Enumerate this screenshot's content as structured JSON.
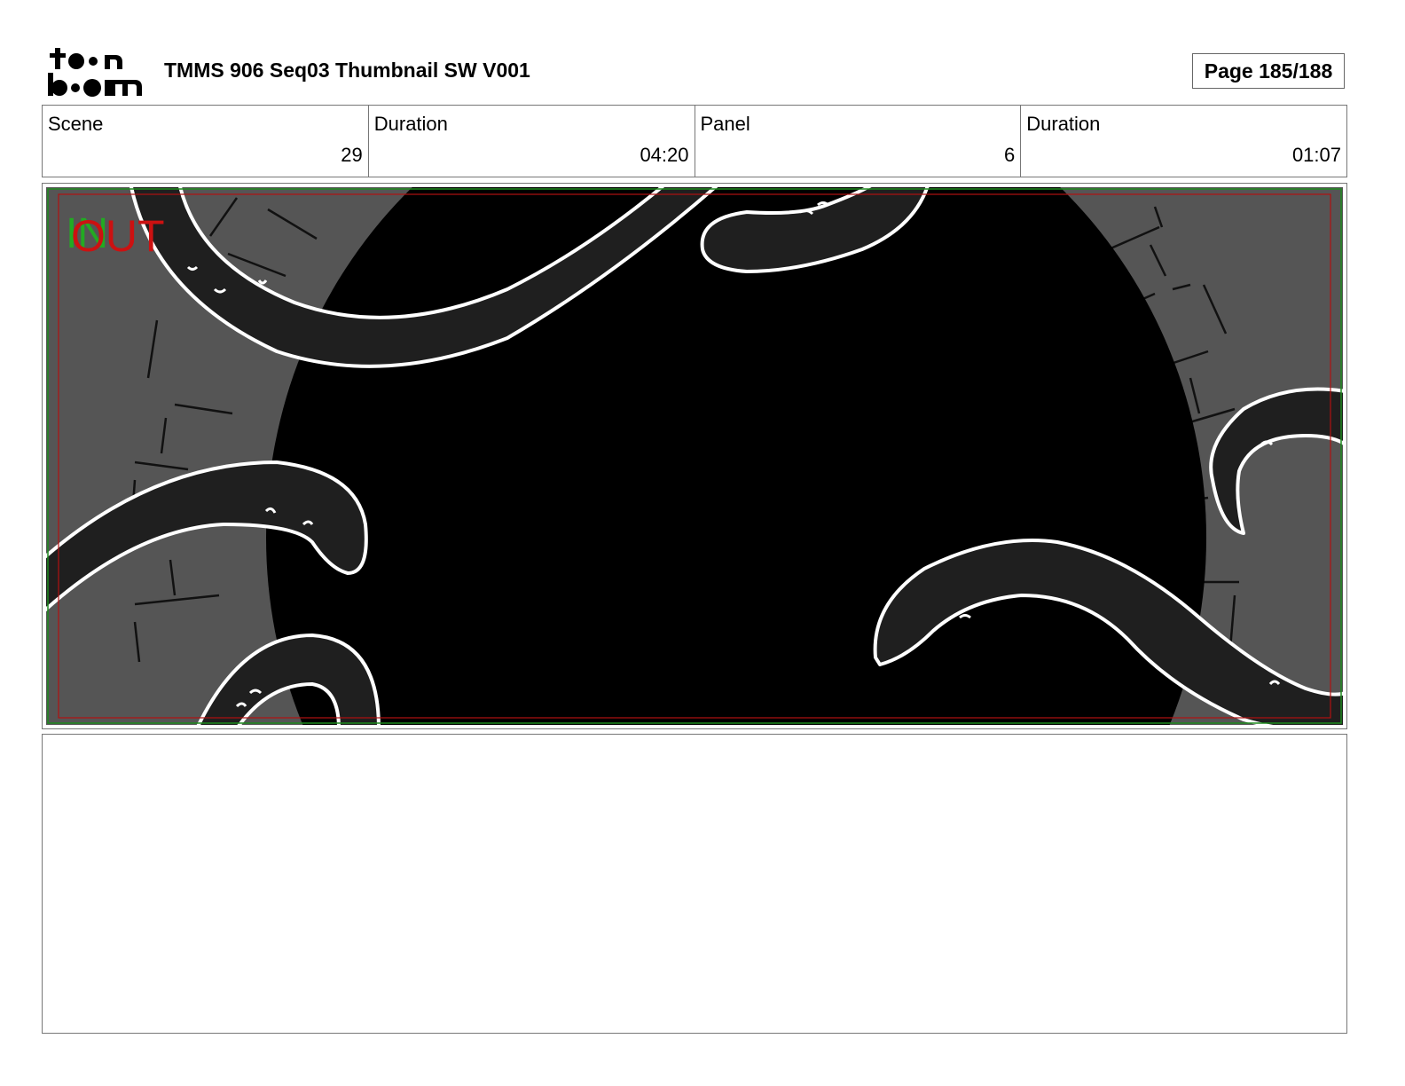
{
  "header": {
    "logo_text": "toonboom",
    "title": "TMMS 906 Seq03 Thumbnail SW V001",
    "page": "Page 185/188"
  },
  "info": {
    "scene_label": "Scene",
    "scene_value": "29",
    "scene_duration_label": "Duration",
    "scene_duration_value": "04:20",
    "panel_label": "Panel",
    "panel_value": "6",
    "panel_duration_label": "Duration",
    "panel_duration_value": "01:07"
  },
  "panel": {
    "in_marker": "IN",
    "out_marker": "OUT",
    "colors": {
      "background": "#000000",
      "wall": "#555555",
      "tentacle_fill": "#1f1f1f",
      "outline": "#ffffff",
      "in_color": "#22aa22",
      "out_color": "#cc1111"
    }
  },
  "notes": {
    "text": ""
  }
}
